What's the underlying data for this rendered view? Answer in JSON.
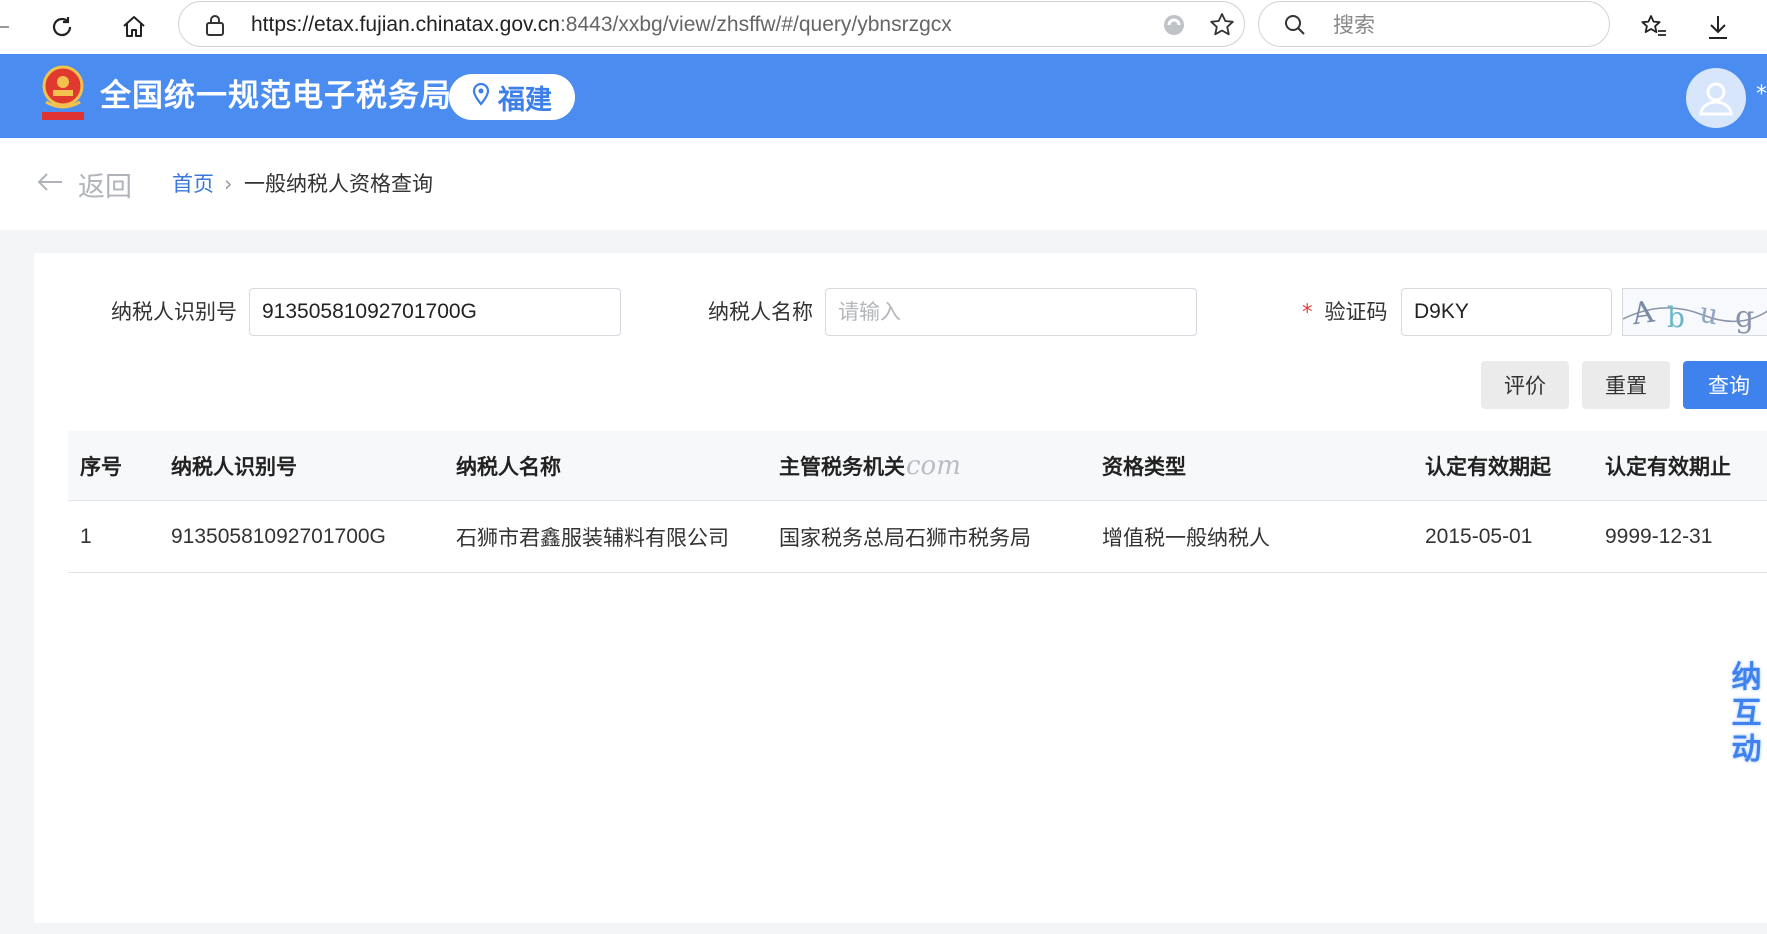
{
  "browser": {
    "url_host": "https://etax.fujian.chinatax.gov.cn",
    "url_path": ":8443/xxbg/view/zhsffw/#/query/ybnsrzgcx",
    "search_placeholder": "搜索"
  },
  "header": {
    "title": "全国统一规范电子税务局",
    "region": "福建"
  },
  "breadcrumb": {
    "back_label": "返回",
    "home": "首页",
    "separator": "›",
    "current": "一般纳税人资格查询"
  },
  "form": {
    "taxpayer_id_label": "纳税人识别号",
    "taxpayer_id_value": "91350581092701700G",
    "taxpayer_name_label": "纳税人名称",
    "taxpayer_name_placeholder": "请输入",
    "captcha_label": "验证码",
    "captcha_required_mark": "*",
    "captcha_value": "D9KY"
  },
  "buttons": {
    "evaluate": "评价",
    "reset": "重置",
    "query": "查询"
  },
  "table": {
    "headers": [
      "序号",
      "纳税人识别号",
      "纳税人名称",
      "主管税务机关",
      "资格类型",
      "认定有效期起",
      "认定有效期止"
    ],
    "rows": [
      [
        "1",
        "91350581092701700G",
        "石狮市君鑫服装辅料有限公司",
        "国家税务总局石狮市税务局",
        "增值税一般纳税人",
        "2015-05-01",
        "9999-12-31"
      ]
    ]
  },
  "watermark": "com",
  "side_widget": [
    "纳",
    "互",
    "动"
  ],
  "colors": {
    "header_blue": "#4a8cf0",
    "primary_button": "#3f82ee",
    "link_blue": "#3a78d8",
    "required_red": "#e4393c"
  }
}
